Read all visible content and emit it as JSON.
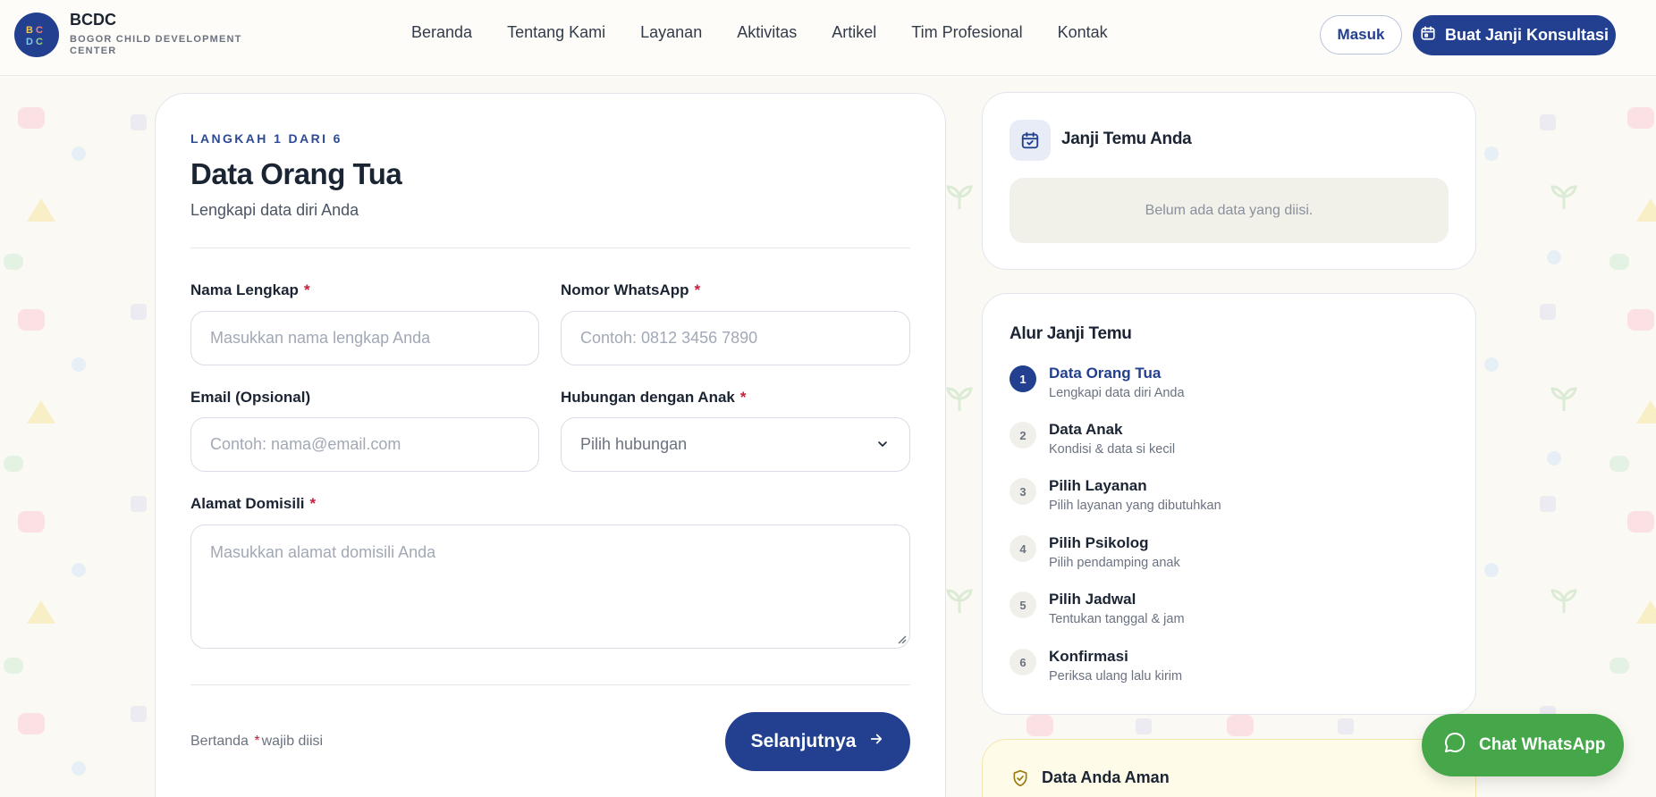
{
  "brand": {
    "name": "BCDC",
    "subtitle": "BOGOR CHILD DEVELOPMENT CENTER",
    "logo_text": "BCDC"
  },
  "nav": {
    "items": [
      "Beranda",
      "Tentang Kami",
      "Layanan",
      "Aktivitas",
      "Artikel",
      "Tim Profesional",
      "Kontak"
    ]
  },
  "header_actions": {
    "login_label": "Masuk",
    "book_label": "Buat Janji Konsultasi"
  },
  "form": {
    "step_label": "LANGKAH 1 DARI 6",
    "title": "Data Orang Tua",
    "subtitle": "Lengkapi data diri Anda",
    "fields": {
      "full_name": {
        "label": "Nama Lengkap",
        "required": "*",
        "placeholder": "Masukkan nama lengkap Anda",
        "value": ""
      },
      "whatsapp": {
        "label": "Nomor WhatsApp",
        "required": "*",
        "placeholder": "Contoh: 0812 3456 7890",
        "value": ""
      },
      "email": {
        "label": "Email (Opsional)",
        "placeholder": "Contoh: nama@email.com",
        "value": ""
      },
      "relationship": {
        "label": "Hubungan dengan Anak",
        "required": "*",
        "selected": "Pilih hubungan"
      },
      "address": {
        "label": "Alamat Domisili",
        "required": "*",
        "placeholder": "Masukkan alamat domisili Anda",
        "value": ""
      }
    },
    "required_note": {
      "before": "Bertanda",
      "star": "*",
      "after": "wajib diisi"
    },
    "next_label": "Selanjutnya"
  },
  "appointment": {
    "title": "Janji Temu Anda",
    "empty_text": "Belum ada data yang diisi."
  },
  "flow": {
    "title": "Alur Janji Temu",
    "steps": [
      {
        "num": "1",
        "title": "Data Orang Tua",
        "desc": "Lengkapi data diri Anda",
        "active": true
      },
      {
        "num": "2",
        "title": "Data Anak",
        "desc": "Kondisi & data si kecil",
        "active": false
      },
      {
        "num": "3",
        "title": "Pilih Layanan",
        "desc": "Pilih layanan yang dibutuhkan",
        "active": false
      },
      {
        "num": "4",
        "title": "Pilih Psikolog",
        "desc": "Pilih pendamping anak",
        "active": false
      },
      {
        "num": "5",
        "title": "Pilih Jadwal",
        "desc": "Tentukan tanggal & jam",
        "active": false
      },
      {
        "num": "6",
        "title": "Konfirmasi",
        "desc": "Periksa ulang lalu kirim",
        "active": false
      }
    ]
  },
  "safety": {
    "title": "Data Anda Aman"
  },
  "whatsapp_chat": {
    "label": "Chat WhatsApp"
  },
  "colors": {
    "primary": "#22408f",
    "required": "#c81e3a",
    "whatsapp": "#45a64a",
    "page_bg": "#fbf9f3"
  },
  "icons": [
    "logo-icon",
    "calendar-icon",
    "chevron-down-icon",
    "arrow-right-icon",
    "calendar-check-icon",
    "shield-check-icon",
    "chat-bubble-icon"
  ]
}
